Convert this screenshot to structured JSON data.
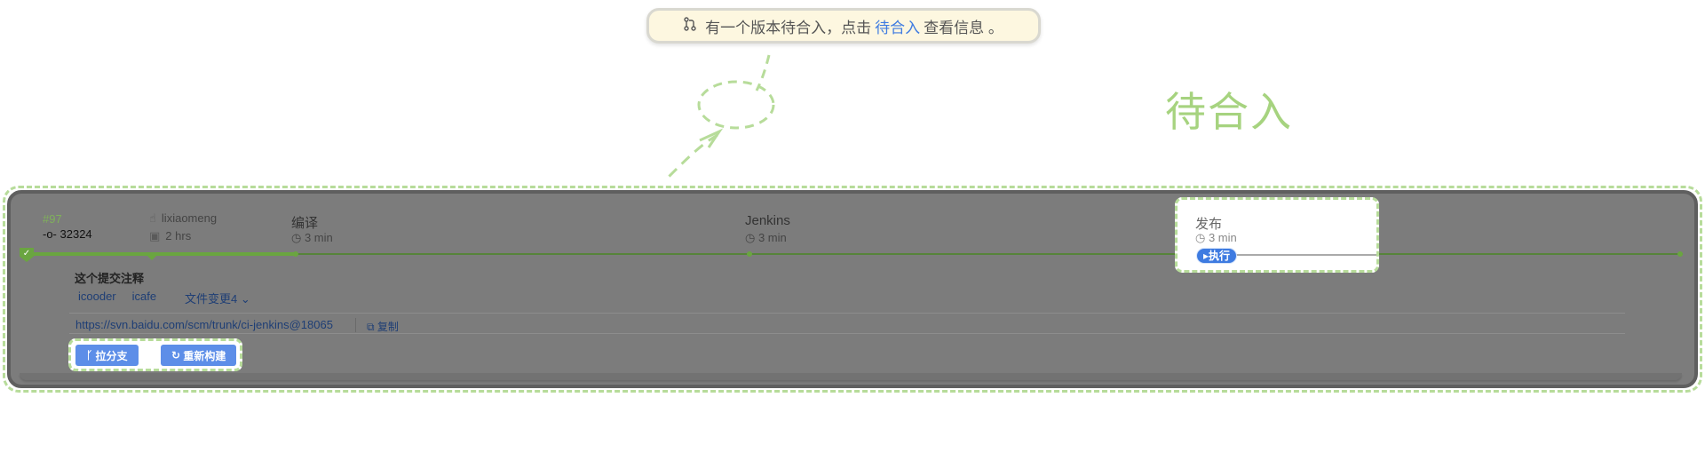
{
  "notice": {
    "icon": "merge-request-icon",
    "text_before": "有一个版本待合入，点击",
    "link": "待合入",
    "text_after": "查看信息 。"
  },
  "big_title": "待合入",
  "build": {
    "number": "#97",
    "commit": "32324",
    "author": "lixiaomeng",
    "ago": "2 hrs"
  },
  "stages": [
    {
      "name": "编译",
      "time": "3 min"
    },
    {
      "name": "Jenkins",
      "time": "3 min"
    },
    {
      "name": "发布",
      "time": "3 min",
      "action": "执行"
    }
  ],
  "commit_message": "这个提交注释",
  "tags": [
    "icooder",
    "icafe"
  ],
  "files_changed": "文件变更4",
  "svn_url": "https://svn.baidu.com/scm/trunk/ci-jenkins@18065",
  "copy_label": "复制",
  "actions": {
    "branch": "拉分支",
    "rebuild": "重新构建"
  },
  "colors": {
    "accent": "#a6d37f",
    "link": "#3e7be1",
    "success": "#6aa540",
    "overlay": "#7c7c7c"
  }
}
